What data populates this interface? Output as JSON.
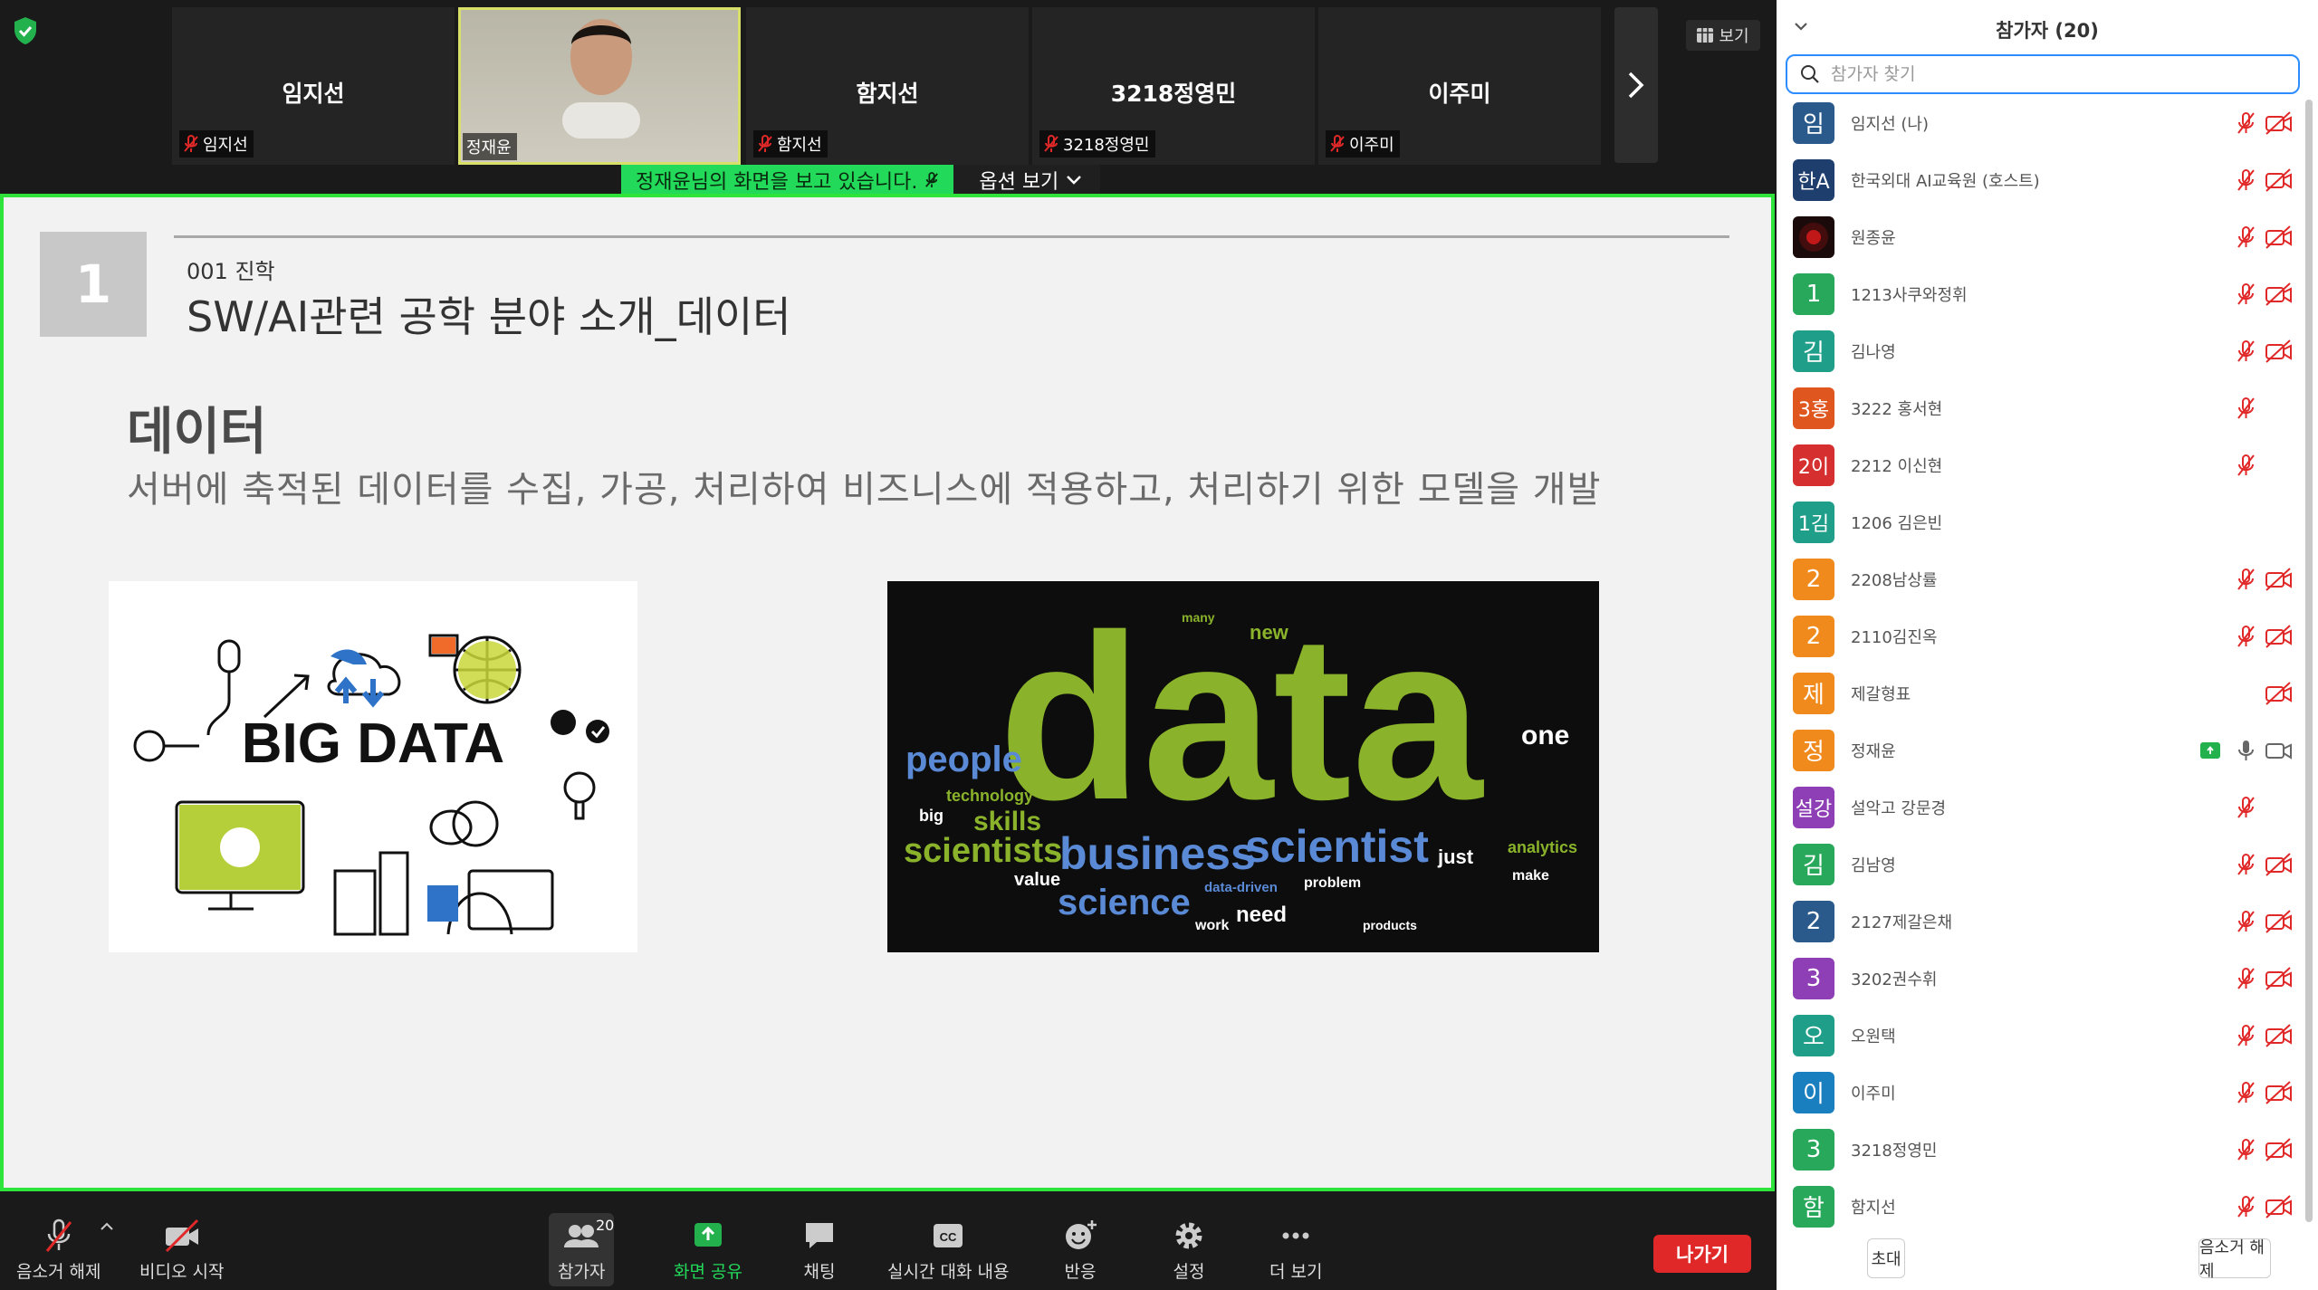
{
  "gallery": {
    "tiles": [
      {
        "name": "임지선",
        "label": "임지선"
      },
      {
        "name": "",
        "label": "정재윤"
      },
      {
        "name": "함지선",
        "label": "함지선"
      },
      {
        "name": "3218정영민",
        "label": "3218정영민"
      },
      {
        "name": "이주미",
        "label": "이주미"
      }
    ],
    "view_label": "보기"
  },
  "share_banner": {
    "message": "정재윤님의 화면을 보고 있습니다.",
    "options_label": "옵션 보기"
  },
  "slide": {
    "number": "1",
    "subtitle": "001 진학",
    "title": "SW/AI관련 공학 분야 소개_데이터",
    "heading": "데이터",
    "description": "서버에 축적된 데이터를 수집, 가공, 처리하여 비즈니스에 적용하고, 처리하기 위한 모델을 개발",
    "bigdata_text": "BIG DATA",
    "wordcloud_main": "data"
  },
  "toolbar": {
    "mute_label": "음소거 해제",
    "video_label": "비디오 시작",
    "participants_label": "참가자",
    "participants_count": "20",
    "share_label": "화면 공유",
    "chat_label": "채팅",
    "captions_label": "실시간 대화 내용",
    "reactions_label": "반응",
    "settings_label": "설정",
    "more_label": "더 보기",
    "leave_label": "나가기"
  },
  "panel": {
    "title": "참가자 (20)",
    "search_placeholder": "참가자 찾기",
    "participants": [
      {
        "avatar": "임",
        "color": "#2a5a8c",
        "name": "임지선 (나)",
        "mic": "off",
        "cam": "off"
      },
      {
        "avatar": "한A",
        "color": "#1e3f6e",
        "name": "한국외대 AI교육원 (호스트)",
        "mic": "off",
        "cam": "off"
      },
      {
        "avatar": "",
        "color": "#1a0a0a",
        "name": "원종윤",
        "mic": "off",
        "cam": "off"
      },
      {
        "avatar": "1",
        "color": "#27a85a",
        "name": "1213사쿠와정휘",
        "mic": "off",
        "cam": "off"
      },
      {
        "avatar": "김",
        "color": "#1f9e8a",
        "name": "김나영",
        "mic": "off",
        "cam": "off"
      },
      {
        "avatar": "3홍",
        "color": "#e0561f",
        "name": "3222 홍서현",
        "mic": "off",
        "cam": "none"
      },
      {
        "avatar": "2이",
        "color": "#d62f2f",
        "name": "2212 이신현",
        "mic": "off",
        "cam": "none"
      },
      {
        "avatar": "1김",
        "color": "#1f9e8a",
        "name": "1206 김은빈",
        "mic": "none",
        "cam": "none"
      },
      {
        "avatar": "2",
        "color": "#f08a1c",
        "name": "2208남상률",
        "mic": "off",
        "cam": "off"
      },
      {
        "avatar": "2",
        "color": "#f08a1c",
        "name": "2110김진옥",
        "mic": "off",
        "cam": "off"
      },
      {
        "avatar": "제",
        "color": "#f08a1c",
        "name": "제갈형표",
        "mic": "none",
        "cam": "off"
      },
      {
        "avatar": "정",
        "color": "#f08a1c",
        "name": "정재윤",
        "mic": "on",
        "cam": "on",
        "sharing": true
      },
      {
        "avatar": "설강",
        "color": "#8e3fb5",
        "name": "설악고 강문경",
        "mic": "off",
        "cam": "none"
      },
      {
        "avatar": "김",
        "color": "#27a85a",
        "name": "김남영",
        "mic": "off",
        "cam": "off"
      },
      {
        "avatar": "2",
        "color": "#2a5a8c",
        "name": "2127제갈은채",
        "mic": "off",
        "cam": "off"
      },
      {
        "avatar": "3",
        "color": "#8e3fb5",
        "name": "3202권수휘",
        "mic": "off",
        "cam": "off"
      },
      {
        "avatar": "오",
        "color": "#1f9e8a",
        "name": "오원택",
        "mic": "off",
        "cam": "off"
      },
      {
        "avatar": "이",
        "color": "#1a7fbf",
        "name": "이주미",
        "mic": "off",
        "cam": "off"
      },
      {
        "avatar": "3",
        "color": "#27a85a",
        "name": "3218정영민",
        "mic": "off",
        "cam": "off"
      },
      {
        "avatar": "함",
        "color": "#27a85a",
        "name": "함지선",
        "mic": "off",
        "cam": "off"
      }
    ],
    "invite_label": "초대",
    "mute_all_label": "음소거 해제"
  }
}
